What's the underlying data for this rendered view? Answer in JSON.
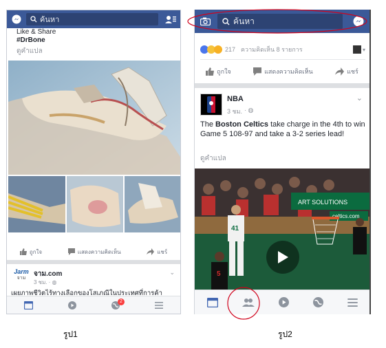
{
  "phone1": {
    "search_placeholder": "ค้นหา",
    "post_text_line1": "Like & Share",
    "post_hashtag": "#DrBone",
    "translate_link": "ดูคำแปล",
    "actions": {
      "like": "ถูกใจ",
      "comment": "แสดงความคิดเห็น",
      "share": "แชร์"
    },
    "next_post": {
      "page_name": "จาม.com",
      "logo_text": "Jarm",
      "logo_sub": "จาม",
      "time": "3 ชม.",
      "text": "เผยภาพชีวิตไร้ทางเลือกของโสเภณีในประเทศที่การค้า"
    },
    "nav_badge": "2"
  },
  "phone2": {
    "search_placeholder": "ค้นหา",
    "reactions_count": "217",
    "comments_count": "ความคิดเห็น 8 รายการ",
    "actions": {
      "like": "ถูกใจ",
      "comment": "แสดงความคิดเห็น",
      "share": "แชร์"
    },
    "post": {
      "page_name": "NBA",
      "time": "3 ชม.",
      "text_before": "The ",
      "text_bold": "Boston Celtics",
      "text_after": " take charge in the 4th to win Game 5 108-97 and take a 3-2 series lead!",
      "translate_link": "ดูคำแปล"
    },
    "video": {
      "player_number": "41",
      "front_player_number": "5",
      "sponsor_text": "celtics.com",
      "banner_text": "ART SOLUTIONS"
    }
  },
  "captions": {
    "left": "รูป1",
    "right": "รูป2"
  },
  "colors": {
    "fb_blue": "#3b5998",
    "annotation_red": "#d0021b"
  }
}
